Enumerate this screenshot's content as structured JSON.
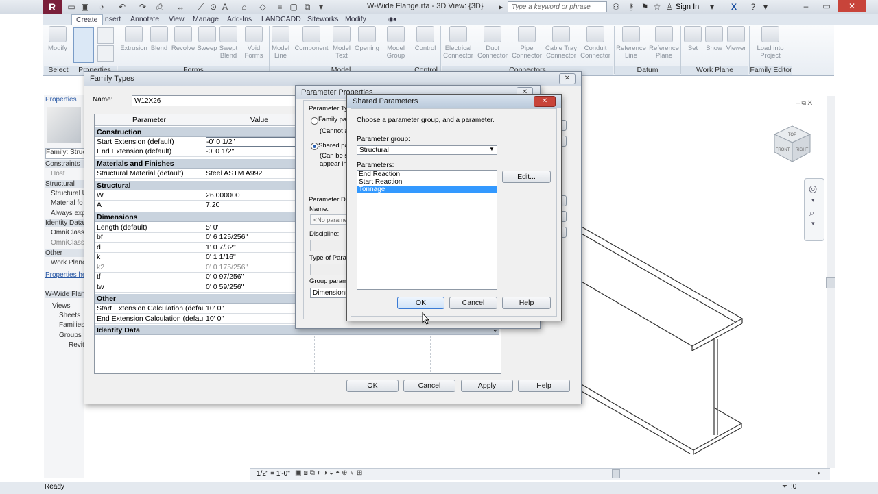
{
  "window": {
    "title": "W-Wide Flange.rfa - 3D View: {3D}",
    "search_placeholder": "Type a keyword or phrase",
    "sign_in": "Sign In",
    "app_icon": "R"
  },
  "tabs": [
    "Create",
    "Insert",
    "Annotate",
    "View",
    "Manage",
    "Add-Ins",
    "LANDCADD",
    "Siteworks",
    "Modify"
  ],
  "ribbon": {
    "buttons": [
      "Modify",
      "Extrusion",
      "Blend",
      "Revolve",
      "Sweep",
      "Swept Blend",
      "Void Forms",
      "Model Line",
      "Component",
      "Model Text",
      "Opening",
      "Model Group",
      "Control",
      "Electrical Connector",
      "Duct Connector",
      "Pipe Connector",
      "Cable Tray Connector",
      "Conduit Connector",
      "Reference Line",
      "Reference Plane",
      "Set",
      "Show",
      "Viewer",
      "Load into Project"
    ],
    "panels": [
      "Select",
      "Properties",
      "Forms",
      "Model",
      "Control",
      "Connectors",
      "Datum",
      "Work Plane",
      "Family Editor"
    ]
  },
  "left_panel": {
    "properties_title": "Properties",
    "rows": [
      "Family: Structural",
      "Constraints",
      "Host",
      "Structural",
      "Structural U",
      "Material fo",
      "Always exp",
      "Identity Data",
      "OmniClass",
      "OmniClass",
      "Other",
      "Work Plane"
    ],
    "properties_help": "Properties help",
    "browser_title": "W-Wide Flange.rfa",
    "browser_items": [
      "Views",
      "Sheets",
      "Families",
      "Groups",
      "Revit Links"
    ]
  },
  "family_types": {
    "title": "Family Types",
    "name_label": "Name:",
    "name_value": "W12X26",
    "col_parameter": "Parameter",
    "col_value": "Value",
    "groups": {
      "construction": "Construction",
      "materials": "Materials and Finishes",
      "structural": "Structural",
      "dimensions": "Dimensions",
      "other": "Other",
      "identity": "Identity Data"
    },
    "rows": {
      "start_ext": {
        "p": "Start Extension (default)",
        "v": "-0'  0 1/2\""
      },
      "end_ext": {
        "p": "End Extension (default)",
        "v": "-0'  0 1/2\""
      },
      "material": {
        "p": "Structural Material (default)",
        "v": "Steel ASTM A992"
      },
      "w": {
        "p": "W",
        "v": "26.000000"
      },
      "a": {
        "p": "A",
        "v": "7.20"
      },
      "length": {
        "p": "Length (default)",
        "v": "5'  0\""
      },
      "bf": {
        "p": "bf",
        "v": "0'  6 125/256\""
      },
      "d": {
        "p": "d",
        "v": "1'  0 7/32\""
      },
      "k": {
        "p": "k",
        "v": "0'  1 1/16\""
      },
      "k2": {
        "p": "k2",
        "v": "0'  0 175/256\""
      },
      "tf": {
        "p": "tf",
        "v": "0'  0 97/256\""
      },
      "tw": {
        "p": "tw",
        "v": "0'  0 59/256\""
      },
      "start_calc": {
        "p": "Start Extension Calculation (default)",
        "v": "10'  0\""
      },
      "end_calc": {
        "p": "End Extension Calculation (default)",
        "v": "10'  0\""
      }
    },
    "buttons": {
      "ok": "OK",
      "cancel": "Cancel",
      "apply": "Apply",
      "help": "Help"
    }
  },
  "parameter_properties": {
    "title": "Parameter Properties",
    "param_type_label": "Parameter Type",
    "family_param": "Family parameter",
    "cannot_line": "(Cannot appear in schedules or tags)",
    "shared_param": "Shared parameter",
    "can_line1": "(Can be shared by multiple projects and families, exported to ODBC, and",
    "can_line2": "appear in schedules and tags)",
    "param_data_label": "Parameter Data",
    "name_label": "Name:",
    "name_value": "<No parameter selected>",
    "discipline_label": "Discipline:",
    "type_label": "Type of Parameter:",
    "group_label": "Group parameter under:",
    "group_value": "Dimensions"
  },
  "shared_parameters": {
    "title": "Shared Parameters",
    "instruction": "Choose a parameter group, and a parameter.",
    "group_label": "Parameter group:",
    "group_value": "Structural",
    "params_label": "Parameters:",
    "params": [
      "End Reaction",
      "Start Reaction",
      "Tonnage"
    ],
    "selected": "Tonnage",
    "edit": "Edit...",
    "ok": "OK",
    "cancel": "Cancel",
    "help": "Help"
  },
  "view_control": {
    "scale": "1/2\" = 1'-0\""
  },
  "status": {
    "text": "Ready",
    "zero": ":0"
  },
  "viewcube": {
    "top": "TOP",
    "front": "FRONT",
    "right": "RIGHT"
  }
}
